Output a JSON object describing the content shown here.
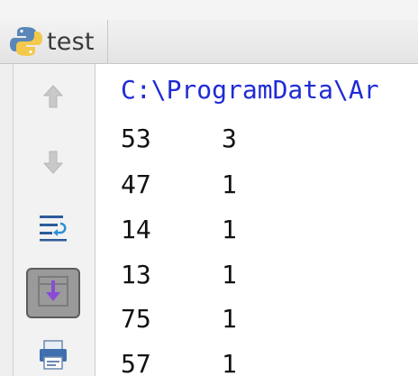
{
  "tab": {
    "label": "test",
    "icon": "python-icon"
  },
  "toolbar": {
    "items": [
      {
        "name": "up-arrow-icon",
        "active": false
      },
      {
        "name": "down-arrow-icon",
        "active": false
      },
      {
        "name": "soft-wrap-icon",
        "active": false
      },
      {
        "name": "scroll-to-end-icon",
        "active": true
      },
      {
        "name": "print-icon",
        "active": false
      }
    ]
  },
  "console": {
    "path": "C:\\ProgramData\\Ar",
    "rows": [
      {
        "a": "53",
        "b": "3"
      },
      {
        "a": "47",
        "b": "1"
      },
      {
        "a": "14",
        "b": "1"
      },
      {
        "a": "13",
        "b": "1"
      },
      {
        "a": "75",
        "b": "1"
      },
      {
        "a": "57",
        "b": "1"
      }
    ]
  },
  "colors": {
    "path_text": "#1f2bd6",
    "output_text": "#111111"
  }
}
